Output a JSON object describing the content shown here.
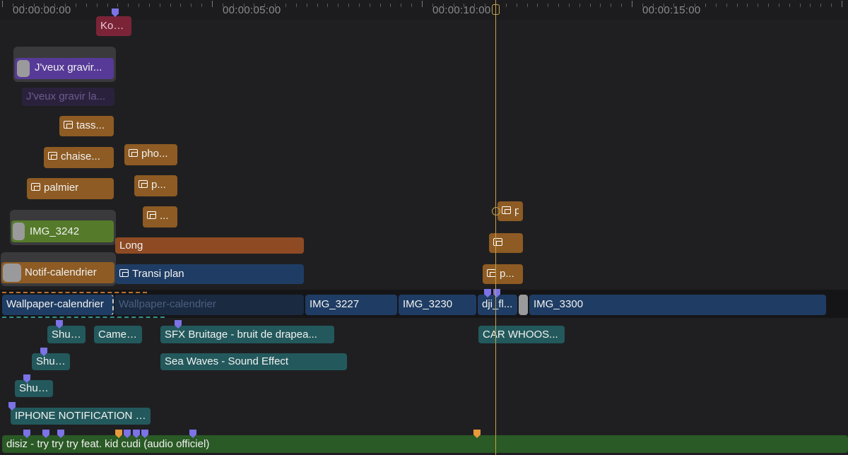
{
  "ruler": {
    "timecodes": [
      "00:00:00:00",
      "00:00:05:00",
      "00:00:10:00",
      "00:00:15:00"
    ]
  },
  "playhead": {
    "timecode": "00:00:10:00"
  },
  "clips": {
    "kodak_title": "Kod...",
    "jveux_gravir_1": "J'veux gravir...",
    "jveux_gravir_2": "J'veux gravir la...",
    "tass": "tass...",
    "chaise": "chaise...",
    "pho": "pho...",
    "palmier": "palmier",
    "p_short": "p...",
    "dots": "...",
    "img_3242": "IMG_3242",
    "long": "Long",
    "notif": "Notif-calendrier",
    "transi": "Transi plan",
    "right_p1": "p",
    "right_p3": "p...",
    "wallpaper_1": "Wallpaper-calendrier",
    "wallpaper_2": "Wallpaper-calendrier",
    "img_3227": "IMG_3227",
    "img_3230": "IMG_3230",
    "dji": "dji_fl...",
    "img_3300": "IMG_3300",
    "shut_1": "Shut...",
    "shut_2": "Shut...",
    "shut_3": "Shut...",
    "camera": "Camer...",
    "sfx": "SFX  Bruitage - bruit de drapea...",
    "sea": "Sea Waves - Sound Effect",
    "car": "CAR WHOOS...",
    "iphone": "IPHONE NOTIFICATION S...",
    "music": "disiz - try try try feat. kid cudi (audio officiel)"
  },
  "colors": {
    "playhead": "#c9a24a",
    "marker": "#7b73e6",
    "chapter_marker": "#e69a3a"
  }
}
